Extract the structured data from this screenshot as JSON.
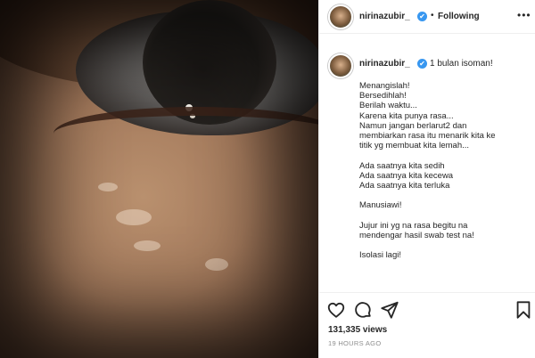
{
  "post": {
    "username": "nirinazubir_",
    "verified_mark": "✔",
    "separator": "•",
    "following_label": "Following",
    "more_icon": "more-options-icon"
  },
  "comment": {
    "username": "nirinazubir_",
    "first_line": "1 bulan isoman!",
    "lines": [
      "Menangislah!",
      "Bersedihlah!",
      "Berilah waktu...",
      "Karena kita punya rasa...",
      "Namun jangan berlarut2 dan",
      "membiarkan rasa itu menarik kita ke",
      "titik yg membuat kita lemah...",
      "",
      "Ada saatnya kita sedih",
      "Ada saatnya kita kecewa",
      "Ada saatnya kita terluka",
      "",
      "Manusiawi!",
      "",
      "Jujur ini yg na rasa begitu na",
      "mendengar hasil swab test na!",
      "",
      "Isolasi lagi!"
    ]
  },
  "actions": {
    "icons": [
      "heart-icon",
      "comment-icon",
      "share-icon",
      "bookmark-icon"
    ],
    "views": "131,335 views",
    "time_ago": "19 HOURS AGO"
  }
}
